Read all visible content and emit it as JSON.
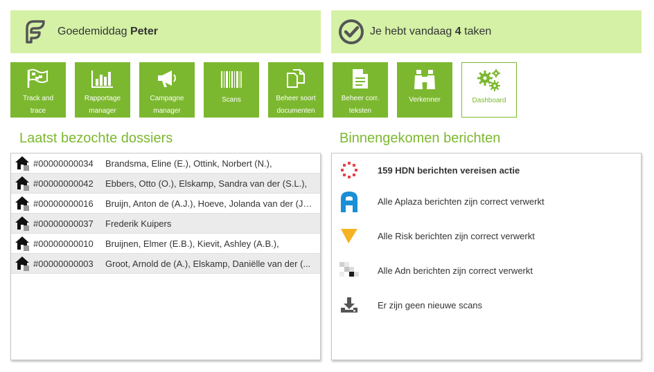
{
  "greeting": {
    "prefix": "Goedemiddag ",
    "name": "Peter"
  },
  "tasks": {
    "prefix": "Je hebt vandaag ",
    "count": "4",
    "suffix": " taken"
  },
  "tiles": [
    {
      "line1": "Track and",
      "line2": "trace",
      "icon": "flag-icon"
    },
    {
      "line1": "Rapportage",
      "line2": "manager",
      "icon": "bar-chart-icon"
    },
    {
      "line1": "Campagne",
      "line2": "manager",
      "icon": "megaphone-icon"
    },
    {
      "line1": "Scans",
      "line2": "",
      "icon": "barcode-icon"
    },
    {
      "line1": "Beheer soort",
      "line2": "documenten",
      "icon": "copy-documents-icon"
    },
    {
      "line1": "Beheer corr.",
      "line2": "teksten",
      "icon": "document-text-icon"
    },
    {
      "line1": "Verkenner",
      "line2": "",
      "icon": "binoculars-icon"
    },
    {
      "line1": "Dashboard",
      "line2": "",
      "icon": "gears-icon"
    }
  ],
  "recent": {
    "title": "Laatst bezochte dossiers",
    "rows": [
      {
        "number": "#00000000034",
        "names": "Brandsma, Eline (E.), Ottink, Norbert (N.),"
      },
      {
        "number": "#00000000042",
        "names": "Ebbers, Otto (O.), Elskamp, Sandra van der (S.L.),"
      },
      {
        "number": "#00000000016",
        "names": "Bruijn, Anton de (A.J.), Hoeve, Jolanda van der (J.L.),"
      },
      {
        "number": "#00000000037",
        "names": "Frederik Kuipers"
      },
      {
        "number": "#00000000010",
        "names": "Bruijnen, Elmer (E.B.), Kievit, Ashley (A.B.),"
      },
      {
        "number": "#00000000003",
        "names": "Groot, Arnold de (A.), Elskamp, Daniëlle van der (..."
      }
    ]
  },
  "messages": {
    "title": "Binnengekomen berichten",
    "items": [
      {
        "text": "159 HDN berichten vereisen actie",
        "icon": "hdn-icon"
      },
      {
        "text": "Alle Aplaza berichten zijn correct verwerkt",
        "icon": "aplaza-icon"
      },
      {
        "text": "Alle Risk berichten zijn correct verwerkt",
        "icon": "risk-icon"
      },
      {
        "text": "Alle Adn berichten zijn correct verwerkt",
        "icon": "adn-icon"
      },
      {
        "text": "Er zijn geen nieuwe scans",
        "icon": "download-icon"
      }
    ]
  },
  "colors": {
    "accent": "#7cb82f",
    "banner": "#d4f1a6",
    "row_alt": "#ebebeb",
    "hdn": "#e8424b",
    "aplaza": "#1a8fd6",
    "risk": "#f5b324"
  }
}
